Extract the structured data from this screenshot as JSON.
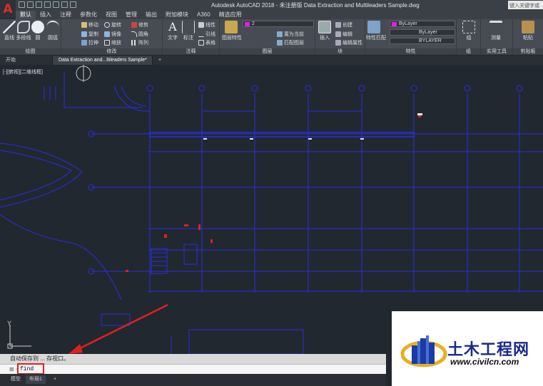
{
  "app": {
    "logo_letter": "A",
    "window_title": "Autodesk AutoCAD 2018 - 未注册版    Data Extraction and Multileaders Sample.dwg",
    "search_text": "键入关键字或"
  },
  "ribbon_tabs": [
    "默认",
    "插入",
    "注释",
    "参数化",
    "视图",
    "管理",
    "输出",
    "附加模块",
    "A360",
    "精选应用"
  ],
  "ribbon": {
    "draw": {
      "title": "绘图",
      "line": "直线",
      "polyline": "多段线",
      "circle": "圆",
      "arc": "圆弧"
    },
    "modify": {
      "title": "修改",
      "move": "移动",
      "rotate": "旋转",
      "trim": "修剪",
      "copy": "复制",
      "mirror": "镜像",
      "fillet": "圆角",
      "stretch": "拉伸",
      "scale": "缩放",
      "array": "阵列"
    },
    "annotation": {
      "title": "注释",
      "text": "文字",
      "dimension": "标注",
      "linear": "线性",
      "leader": "引线",
      "table": "表格"
    },
    "layers": {
      "title": "图层",
      "layer_props": "图层特性",
      "layer_value": "2",
      "set_current": "置为当前",
      "match_layer": "匹配图层"
    },
    "block": {
      "title": "块",
      "insert": "插入",
      "create": "创建",
      "edit": "编辑",
      "edit_attr": "编辑属性"
    },
    "properties": {
      "title": "特性",
      "match": "特性匹配",
      "color": "ByLayer",
      "linetype": "ByLayer",
      "lineweight": "BYLAYER"
    },
    "groups": {
      "title": "组",
      "group": "组"
    },
    "utilities": {
      "title": "实用工具",
      "measure": "测量"
    },
    "clipboard": {
      "title": "剪贴板",
      "paste": "粘贴"
    }
  },
  "file_tabs": [
    "开始",
    "Data Extraction and...ltileaders Sample*"
  ],
  "viewport_label": "[-][俯视][二维线框]",
  "command": {
    "history": "自动保存到 ... 存视口。",
    "prompt": "⊠ ▫",
    "input": "find"
  },
  "layout_tabs": [
    "模型",
    "布局1"
  ],
  "watermark": {
    "name": "土木工程网",
    "url": "www.civilcn.com"
  },
  "colors": {
    "accent_red": "#e02020",
    "grid_blue": "#2a2ee0",
    "canvas_bg": "#212830"
  }
}
